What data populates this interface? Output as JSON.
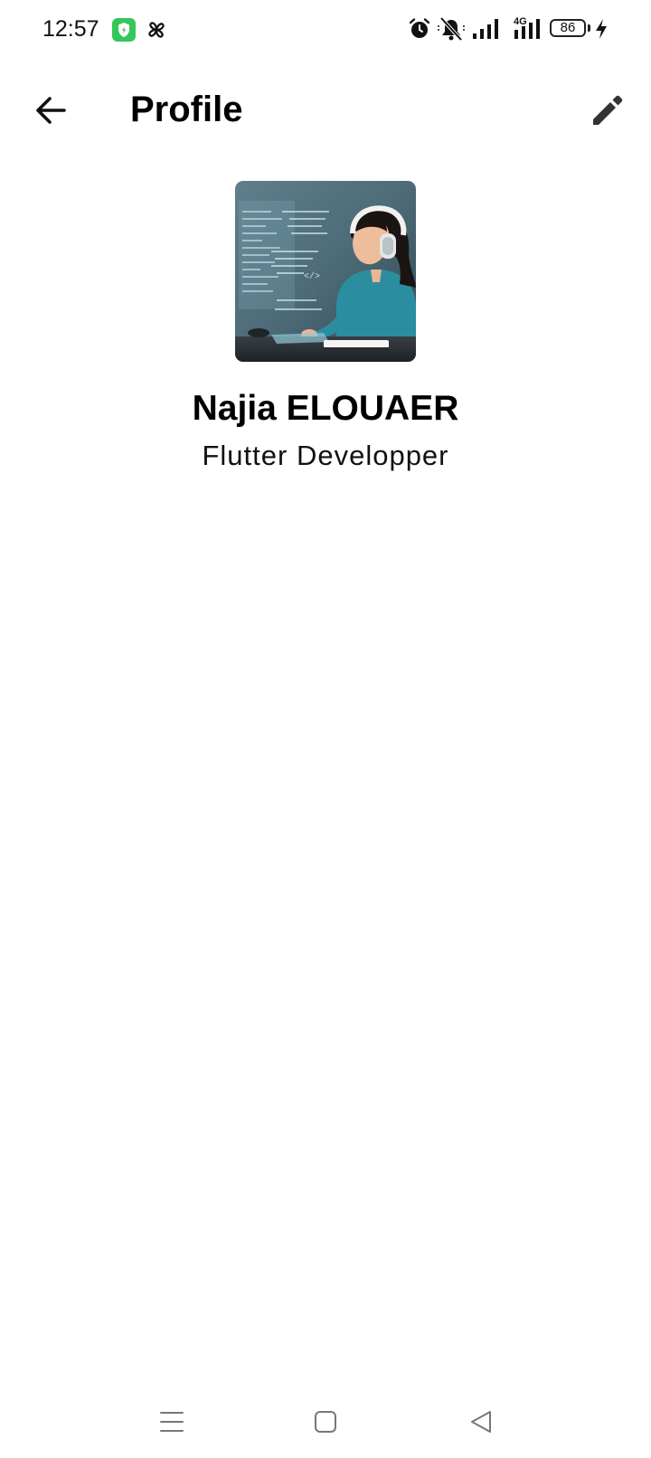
{
  "status_bar": {
    "time": "12:57",
    "network_label": "4G",
    "battery_level": "86",
    "icons": [
      "shield-app-icon",
      "pinwheel-app-icon",
      "alarm-icon",
      "bell-muted-icon",
      "signal-icon",
      "signal-4g-icon",
      "battery-icon",
      "charging-icon"
    ],
    "accent_colors": {
      "shield_app": "#34c759"
    }
  },
  "app_bar": {
    "title": "Profile",
    "back_icon": "arrow-left-icon",
    "edit_icon": "pencil-icon"
  },
  "profile": {
    "name": "Najia ELOUAER",
    "role": "Flutter Developper",
    "avatar_alt": "profile-photo"
  },
  "nav_bar": {
    "icons": [
      "menu-icon",
      "home-square-icon",
      "back-triangle-icon"
    ]
  }
}
